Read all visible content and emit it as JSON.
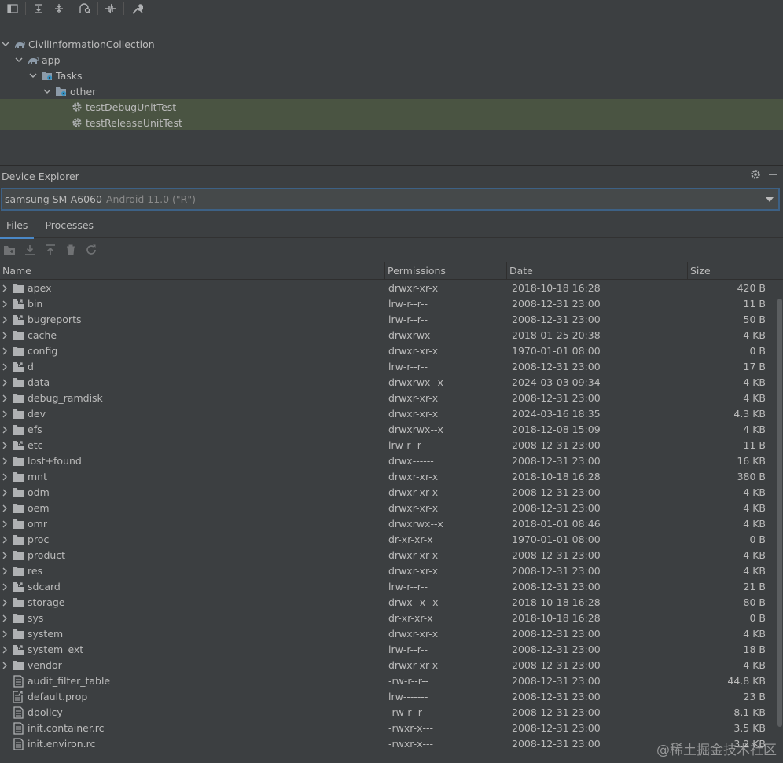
{
  "gradle_toolbar": {
    "icons": [
      "panel-icon",
      "expand-all-icon",
      "collapse-all-icon",
      "analyze-icon",
      "toggle-offline-icon",
      "wrench-icon"
    ]
  },
  "gradle_tree": [
    {
      "label": "CivilInformationCollection",
      "icon": "gradle-elephant-icon",
      "level": 0,
      "expanded": true
    },
    {
      "label": "app",
      "icon": "gradle-elephant-icon",
      "level": 1,
      "expanded": true
    },
    {
      "label": "Tasks",
      "icon": "task-folder-icon",
      "level": 2,
      "expanded": true
    },
    {
      "label": "other",
      "icon": "task-folder-icon",
      "level": 3,
      "expanded": true
    },
    {
      "label": "testDebugUnitTest",
      "icon": "gear-icon",
      "level": 4,
      "selected": true
    },
    {
      "label": "testReleaseUnitTest",
      "icon": "gear-icon",
      "level": 4,
      "selected": true
    }
  ],
  "device_explorer": {
    "title": "Device Explorer",
    "device_name": "samsung SM-A6060",
    "device_version": "Android 11.0 (\"R\")",
    "tabs": [
      "Files",
      "Processes"
    ],
    "columns": [
      "Name",
      "Permissions",
      "Date",
      "Size"
    ],
    "files": [
      {
        "name": "apex",
        "type": "folder",
        "perm": "drwxr-xr-x",
        "date": "2018-10-18 16:28",
        "size": "420 B"
      },
      {
        "name": "bin",
        "type": "link",
        "perm": "lrw-r--r--",
        "date": "2008-12-31 23:00",
        "size": "11 B"
      },
      {
        "name": "bugreports",
        "type": "link",
        "perm": "lrw-r--r--",
        "date": "2008-12-31 23:00",
        "size": "50 B"
      },
      {
        "name": "cache",
        "type": "folder",
        "perm": "drwxrwx---",
        "date": "2018-01-25 20:38",
        "size": "4 KB"
      },
      {
        "name": "config",
        "type": "folder",
        "perm": "drwxr-xr-x",
        "date": "1970-01-01 08:00",
        "size": "0 B"
      },
      {
        "name": "d",
        "type": "link",
        "perm": "lrw-r--r--",
        "date": "2008-12-31 23:00",
        "size": "17 B"
      },
      {
        "name": "data",
        "type": "folder",
        "perm": "drwxrwx--x",
        "date": "2024-03-03 09:34",
        "size": "4 KB"
      },
      {
        "name": "debug_ramdisk",
        "type": "folder",
        "perm": "drwxr-xr-x",
        "date": "2008-12-31 23:00",
        "size": "4 KB"
      },
      {
        "name": "dev",
        "type": "folder",
        "perm": "drwxr-xr-x",
        "date": "2024-03-16 18:35",
        "size": "4.3 KB"
      },
      {
        "name": "efs",
        "type": "folder",
        "perm": "drwxrwx--x",
        "date": "2018-12-08 15:09",
        "size": "4 KB"
      },
      {
        "name": "etc",
        "type": "link",
        "perm": "lrw-r--r--",
        "date": "2008-12-31 23:00",
        "size": "11 B"
      },
      {
        "name": "lost+found",
        "type": "folder",
        "perm": "drwx------",
        "date": "2008-12-31 23:00",
        "size": "16 KB"
      },
      {
        "name": "mnt",
        "type": "folder",
        "perm": "drwxr-xr-x",
        "date": "2018-10-18 16:28",
        "size": "380 B"
      },
      {
        "name": "odm",
        "type": "folder",
        "perm": "drwxr-xr-x",
        "date": "2008-12-31 23:00",
        "size": "4 KB"
      },
      {
        "name": "oem",
        "type": "folder",
        "perm": "drwxr-xr-x",
        "date": "2008-12-31 23:00",
        "size": "4 KB"
      },
      {
        "name": "omr",
        "type": "folder",
        "perm": "drwxrwx--x",
        "date": "2018-01-01 08:46",
        "size": "4 KB"
      },
      {
        "name": "proc",
        "type": "folder",
        "perm": "dr-xr-xr-x",
        "date": "1970-01-01 08:00",
        "size": "0 B"
      },
      {
        "name": "product",
        "type": "folder",
        "perm": "drwxr-xr-x",
        "date": "2008-12-31 23:00",
        "size": "4 KB"
      },
      {
        "name": "res",
        "type": "folder",
        "perm": "drwxr-xr-x",
        "date": "2008-12-31 23:00",
        "size": "4 KB"
      },
      {
        "name": "sdcard",
        "type": "link",
        "perm": "lrw-r--r--",
        "date": "2008-12-31 23:00",
        "size": "21 B"
      },
      {
        "name": "storage",
        "type": "folder",
        "perm": "drwx--x--x",
        "date": "2018-10-18 16:28",
        "size": "80 B"
      },
      {
        "name": "sys",
        "type": "folder",
        "perm": "dr-xr-xr-x",
        "date": "2018-10-18 16:28",
        "size": "0 B"
      },
      {
        "name": "system",
        "type": "folder",
        "perm": "drwxr-xr-x",
        "date": "2008-12-31 23:00",
        "size": "4 KB"
      },
      {
        "name": "system_ext",
        "type": "link",
        "perm": "lrw-r--r--",
        "date": "2008-12-31 23:00",
        "size": "18 B"
      },
      {
        "name": "vendor",
        "type": "folder",
        "perm": "drwxr-xr-x",
        "date": "2008-12-31 23:00",
        "size": "4 KB"
      },
      {
        "name": "audit_filter_table",
        "type": "file",
        "perm": "-rw-r--r--",
        "date": "2008-12-31 23:00",
        "size": "44.8 KB"
      },
      {
        "name": "default.prop",
        "type": "filelink",
        "perm": "lrw-------",
        "date": "2008-12-31 23:00",
        "size": "23 B"
      },
      {
        "name": "dpolicy",
        "type": "file",
        "perm": "-rw-r--r--",
        "date": "2008-12-31 23:00",
        "size": "8.1 KB"
      },
      {
        "name": "init.container.rc",
        "type": "file",
        "perm": "-rwxr-x---",
        "date": "2008-12-31 23:00",
        "size": "3.5 KB"
      },
      {
        "name": "init.environ.rc",
        "type": "file",
        "perm": "-rwxr-x---",
        "date": "2008-12-31 23:00",
        "size": "3.2 KB"
      }
    ]
  },
  "watermark": "@稀土掘金技术社区",
  "colors": {
    "background": "#3c3f41",
    "selection": "#4a5442",
    "accent": "#4a88c7",
    "text": "#bbbbbb"
  }
}
